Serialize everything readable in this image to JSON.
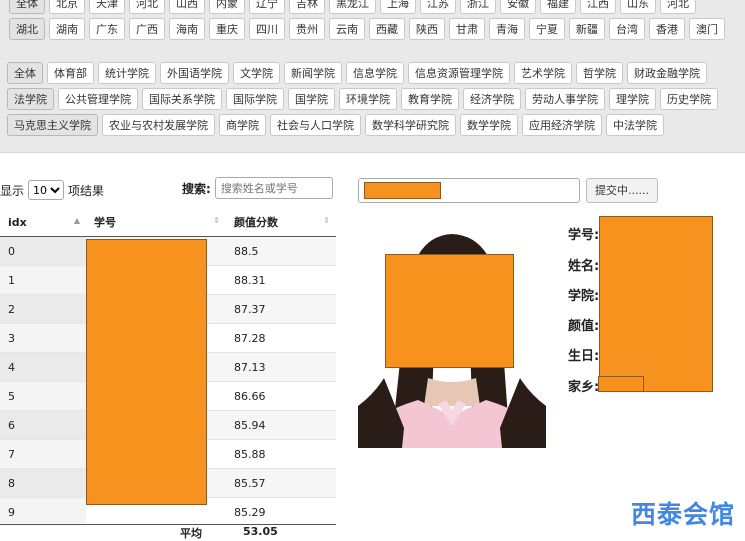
{
  "regions": {
    "row1": [
      "全体",
      "北京",
      "天津",
      "河北",
      "山西",
      "内蒙",
      "辽宁",
      "吉林",
      "黑龙江",
      "上海",
      "江苏",
      "浙江",
      "安徽",
      "福建",
      "江西",
      "山东",
      "河北"
    ],
    "row2": [
      "湖北",
      "湖南",
      "广东",
      "广西",
      "海南",
      "重庆",
      "四川",
      "贵州",
      "云南",
      "西藏",
      "陕西",
      "甘肃",
      "青海",
      "宁夏",
      "新疆",
      "台湾",
      "香港",
      "澳门"
    ]
  },
  "colleges": {
    "row1": [
      "全体",
      "体育部",
      "统计学院",
      "外国语学院",
      "文学院",
      "新闻学院",
      "信息学院",
      "信息资源管理学院",
      "艺术学院",
      "哲学院",
      "财政金融学院"
    ],
    "row2": [
      "法学院",
      "公共管理学院",
      "国际关系学院",
      "国际学院",
      "国学院",
      "环境学院",
      "教育学院",
      "经济学院",
      "劳动人事学院",
      "理学院",
      "历史学院"
    ],
    "row3": [
      "马克思主义学院",
      "农业与农村发展学院",
      "商学院",
      "社会与人口学院",
      "数学科学研究院",
      "数学学院",
      "应用经济学院",
      "中法学院"
    ]
  },
  "table_controls": {
    "show_label": "显示",
    "length_value": "10",
    "items_label": "项结果",
    "search_label": "搜索:",
    "search_placeholder": "搜索姓名或学号"
  },
  "table": {
    "headers": [
      "idx",
      "学号",
      "颜值分数"
    ],
    "rows": [
      {
        "idx": "0",
        "score": "88.5"
      },
      {
        "idx": "1",
        "score": "88.31"
      },
      {
        "idx": "2",
        "score": "87.37"
      },
      {
        "idx": "3",
        "score": "87.28"
      },
      {
        "idx": "4",
        "score": "87.13"
      },
      {
        "idx": "5",
        "score": "86.66"
      },
      {
        "idx": "6",
        "score": "85.94"
      },
      {
        "idx": "7",
        "score": "85.88"
      },
      {
        "idx": "8",
        "score": "85.57"
      },
      {
        "idx": "9",
        "score": "85.29"
      }
    ],
    "avg_label": "平均",
    "avg_value": "53.05"
  },
  "submit": {
    "button_label": "提交中......"
  },
  "profile": {
    "labels": [
      "学号:",
      "姓名:",
      "学院:",
      "颜值:",
      "生日:",
      "家乡:"
    ]
  },
  "watermark": "西泰会馆",
  "colors": {
    "redaction": "#f7921e",
    "watermark": "#2f7be0"
  }
}
